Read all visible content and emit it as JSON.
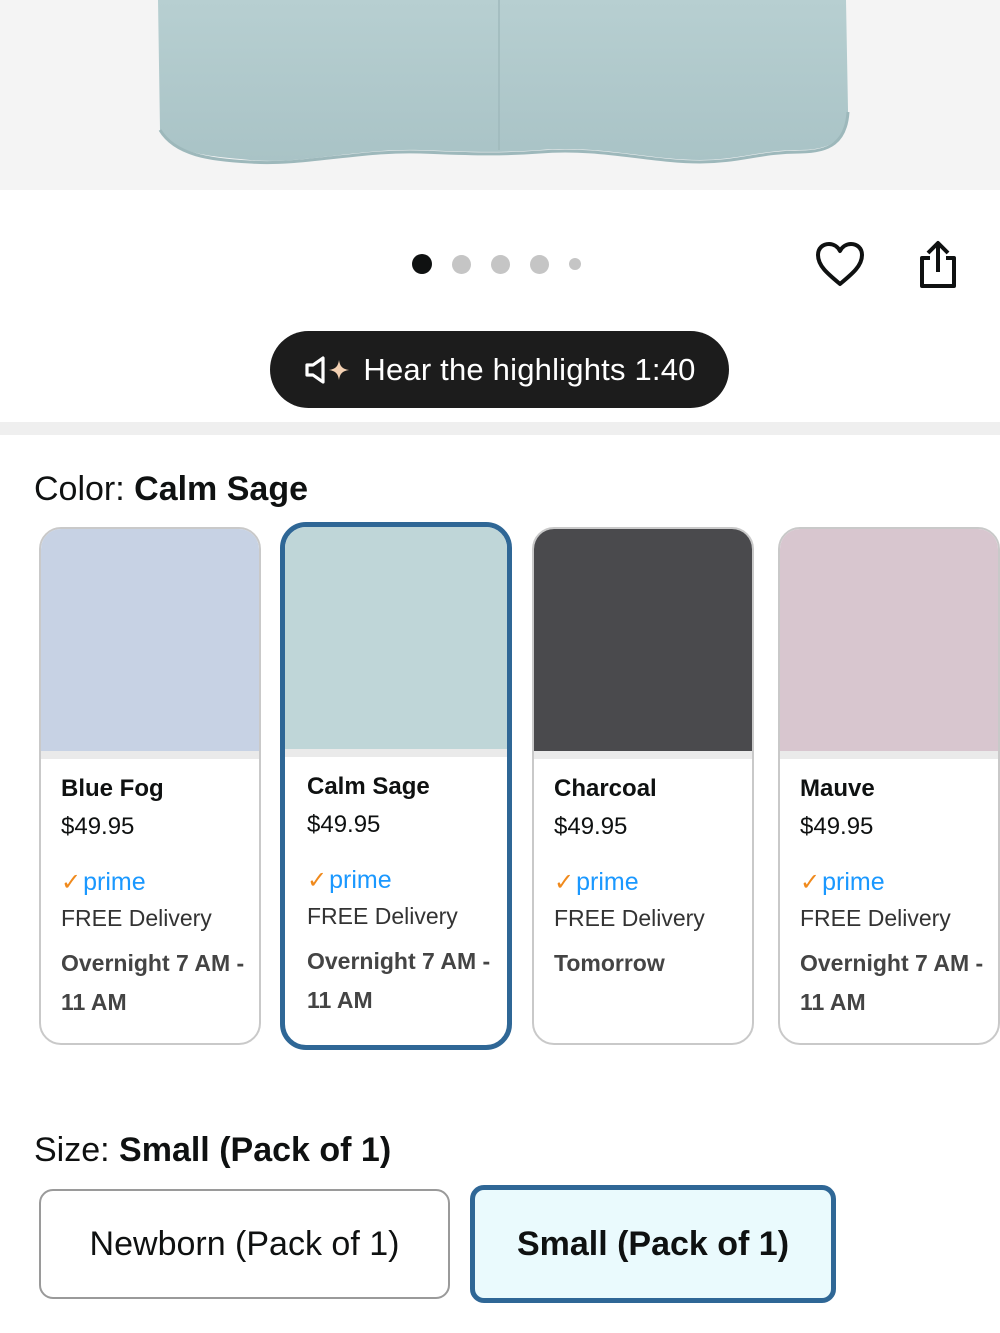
{
  "carousel": {
    "total": 5,
    "active_index": 0
  },
  "audio": {
    "label": "Hear the highlights 1:40"
  },
  "color": {
    "prefix": "Color: ",
    "selected": "Calm Sage",
    "options": [
      {
        "name": "Blue Fog",
        "price": "$49.95",
        "prime": "prime",
        "delivery": "FREE Delivery",
        "when": "Overnight 7 AM - 11 AM",
        "swatch_color": "#c7d2e4"
      },
      {
        "name": "Calm Sage",
        "price": "$49.95",
        "prime": "prime",
        "delivery": "FREE Delivery",
        "when": "Overnight 7 AM - 11 AM",
        "swatch_color": "#bfd6d8"
      },
      {
        "name": "Charcoal",
        "price": "$49.95",
        "prime": "prime",
        "delivery": "FREE Delivery",
        "when": "Tomorrow",
        "swatch_color": "#4a4a4d"
      },
      {
        "name": "Mauve",
        "price": "$49.95",
        "prime": "prime",
        "delivery": "FREE Delivery",
        "when": "Overnight 7 AM - 11 AM",
        "swatch_color": "#d8c6cf"
      }
    ]
  },
  "size": {
    "prefix": "Size: ",
    "selected": "Small (Pack of 1)",
    "options": [
      "Newborn (Pack of 1)",
      "Small (Pack of 1)"
    ]
  },
  "colors": {
    "accent": "#2f6796",
    "prime_blue": "#1a98ff",
    "prime_check": "#f08a1d",
    "product": "#b9d0d2"
  },
  "icons": {
    "wishlist": "heart-icon",
    "share": "share-icon",
    "audio": "speaker-sparkle-icon"
  }
}
